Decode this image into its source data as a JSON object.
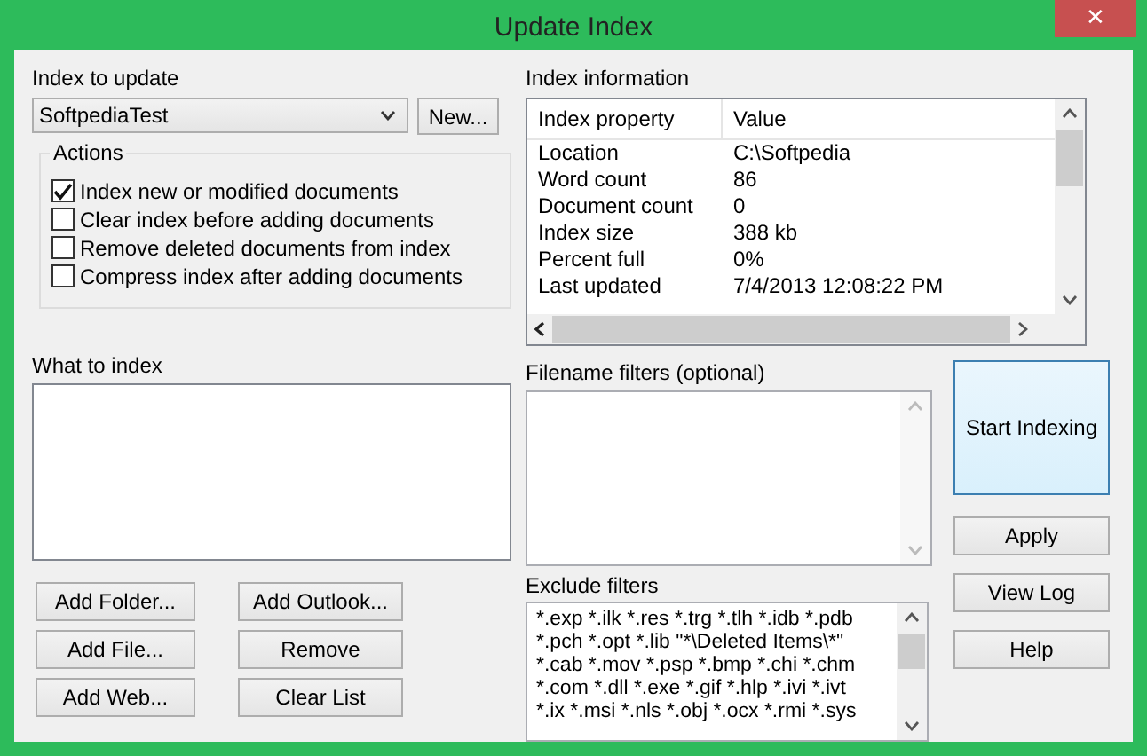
{
  "window": {
    "title": "Update Index",
    "close": "✕"
  },
  "index_to_update": {
    "label": "Index to update",
    "value": "SoftpediaTest",
    "new_button": "New..."
  },
  "actions": {
    "title": "Actions",
    "options": [
      {
        "label": "Index new or modified documents",
        "checked": true
      },
      {
        "label": "Clear index before adding documents",
        "checked": false
      },
      {
        "label": "Remove deleted documents from index",
        "checked": false
      },
      {
        "label": "Compress index after adding documents",
        "checked": false
      }
    ]
  },
  "what_to_index": {
    "label": "What to index",
    "buttons": [
      "Add Folder...",
      "Add Outlook...",
      "Add File...",
      "Remove",
      "Add Web...",
      "Clear List"
    ]
  },
  "index_information": {
    "label": "Index information",
    "columns": [
      "Index property",
      "Value"
    ],
    "rows": [
      [
        "Location",
        "C:\\Softpedia"
      ],
      [
        "Word count",
        "86"
      ],
      [
        "Document count",
        "0"
      ],
      [
        "Index size",
        "388 kb"
      ],
      [
        "Percent full",
        "0%"
      ],
      [
        "Last updated",
        "7/4/2013 12:08:22 PM"
      ]
    ]
  },
  "filename_filters": {
    "label": "Filename filters (optional)"
  },
  "exclude_filters": {
    "label": "Exclude filters",
    "lines": [
      "*.exp *.ilk *.res *.trg *.tlh *.idb *.pdb",
      "*.pch *.opt *.lib \"*\\Deleted Items\\*\"",
      "*.cab *.mov *.psp *.bmp *.chi *.chm",
      "*.com *.dll *.exe *.gif *.hlp *.ivi *.ivt",
      "*.ix *.msi *.nls *.obj *.ocx *.rmi *.sys"
    ]
  },
  "side_buttons": [
    {
      "label": "Start Indexing",
      "kind": "primary"
    },
    {
      "label": "Apply",
      "kind": "normal"
    },
    {
      "label": "View Log",
      "kind": "normal"
    },
    {
      "label": "Help",
      "kind": "normal"
    }
  ]
}
